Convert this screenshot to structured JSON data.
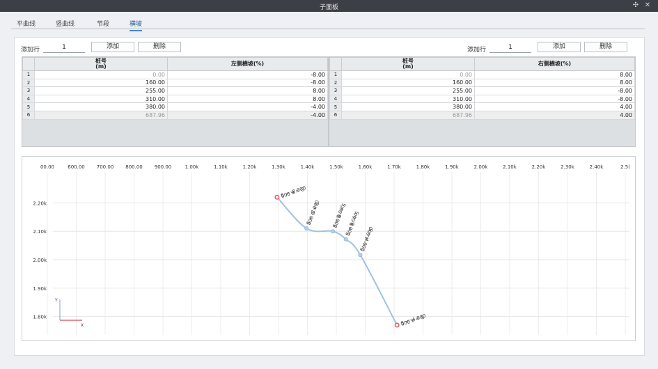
{
  "window": {
    "title": "子面板",
    "pin_glyph": "✣",
    "close_glyph": "✕"
  },
  "tabs": [
    "平曲线",
    "竖曲线",
    "节段",
    "横坡"
  ],
  "active_tab": 3,
  "left_panel": {
    "add_row_label": "添加行",
    "add_row_value": "1",
    "add_label": "添加",
    "delete_label": "删除",
    "col_station": "桩号",
    "col_station_unit": "(m)",
    "col_slope": "左侧横坡(%)",
    "rows": [
      {
        "n": "1",
        "station": "0.00",
        "slope": "-8.00"
      },
      {
        "n": "2",
        "station": "160.00",
        "slope": "-8.00"
      },
      {
        "n": "3",
        "station": "255.00",
        "slope": "8.00"
      },
      {
        "n": "4",
        "station": "310.00",
        "slope": "8.00"
      },
      {
        "n": "5",
        "station": "380.00",
        "slope": "-4.00"
      },
      {
        "n": "6",
        "station": "687.96",
        "slope": "-4.00"
      }
    ]
  },
  "right_panel": {
    "add_row_label": "添加行",
    "add_row_value": "1",
    "add_label": "添加",
    "delete_label": "删除",
    "col_station": "桩号",
    "col_station_unit": "(m)",
    "col_slope": "右侧横坡(%)",
    "rows": [
      {
        "n": "1",
        "station": "0.00",
        "slope": "8.00"
      },
      {
        "n": "2",
        "station": "160.00",
        "slope": "8.00"
      },
      {
        "n": "3",
        "station": "255.00",
        "slope": "-8.00"
      },
      {
        "n": "4",
        "station": "310.00",
        "slope": "-8.00"
      },
      {
        "n": "5",
        "station": "380.00",
        "slope": "4.00"
      },
      {
        "n": "6",
        "station": "687.96",
        "slope": "4.00"
      }
    ]
  },
  "plot": {
    "x_ticks": [
      {
        "v": 500,
        "label": "00.00"
      },
      {
        "v": 600,
        "label": "600.00"
      },
      {
        "v": 700,
        "label": "700.00"
      },
      {
        "v": 800,
        "label": "800.00"
      },
      {
        "v": 900,
        "label": "900.00"
      },
      {
        "v": 1000,
        "label": "1.00k"
      },
      {
        "v": 1100,
        "label": "1.10k"
      },
      {
        "v": 1200,
        "label": "1.20k"
      },
      {
        "v": 1300,
        "label": "1.30k"
      },
      {
        "v": 1400,
        "label": "1.40k"
      },
      {
        "v": 1500,
        "label": "1.50k"
      },
      {
        "v": 1600,
        "label": "1.60k"
      },
      {
        "v": 1700,
        "label": "1.70k"
      },
      {
        "v": 1800,
        "label": "1.80k"
      },
      {
        "v": 1900,
        "label": "1.90k"
      },
      {
        "v": 2000,
        "label": "2.00k"
      },
      {
        "v": 2100,
        "label": "2.10k"
      },
      {
        "v": 2200,
        "label": "2.20k"
      },
      {
        "v": 2300,
        "label": "2.30k"
      },
      {
        "v": 2400,
        "label": "2.40k"
      },
      {
        "v": 2500,
        "label": "2.5("
      }
    ],
    "y_ticks": [
      {
        "v": 2200,
        "label": "2.20k"
      },
      {
        "v": 2100,
        "label": "2.10k"
      },
      {
        "v": 2000,
        "label": "2.00k"
      },
      {
        "v": 1900,
        "label": "1.90k"
      },
      {
        "v": 1800,
        "label": "1.80k"
      }
    ],
    "x_range": [
      500,
      2500
    ],
    "y_range": [
      1760,
      2250
    ],
    "axis_indicator": {
      "y_label": "Y",
      "x_label": "X"
    },
    "route_color": "#9fc1e3",
    "endpoint_color": "#e0393e",
    "vertex_color": "#b7d0ea",
    "points": [
      {
        "x": 1295,
        "y": 2220,
        "kind": "end",
        "left": "S = -8.000",
        "right": "S = 8.000"
      },
      {
        "x": 1397,
        "y": 2110,
        "kind": "mid",
        "left": "S = -8.000",
        "right": "S = 8.000"
      },
      {
        "x": 1488,
        "y": 2100,
        "kind": "mid",
        "left": "S = 8.000",
        "right": "S = -8.000"
      },
      {
        "x": 1533,
        "y": 2072,
        "kind": "mid",
        "left": "S = 8.000",
        "right": "S = -8.000"
      },
      {
        "x": 1583,
        "y": 2017,
        "kind": "mid",
        "left": "S = -4.000",
        "right": "S = 4.000"
      },
      {
        "x": 1710,
        "y": 1770,
        "kind": "end",
        "left": "S = -4.000",
        "right": "S = 4.000"
      }
    ]
  }
}
